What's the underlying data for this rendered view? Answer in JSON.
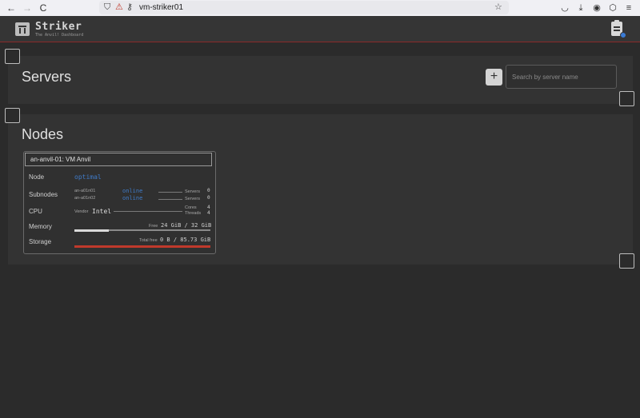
{
  "browser": {
    "url": "vm-striker01",
    "back_icon": "←",
    "forward_icon": "→",
    "reload_icon": "C"
  },
  "app": {
    "title": "Striker",
    "subtitle": "The Anvil! Dashboard"
  },
  "servers": {
    "heading": "Servers",
    "add_label": "+",
    "search_placeholder": "Search by server name"
  },
  "nodes": {
    "heading": "Nodes",
    "card": {
      "title": "an-anvil-01: VM Anvil",
      "node": {
        "label": "Node",
        "status": "optimal"
      },
      "subnodes": {
        "label": "Subnodes",
        "items": [
          {
            "name": "an-a01n01",
            "status": "online",
            "servers_label": "Servers",
            "servers": "0"
          },
          {
            "name": "an-a01n02",
            "status": "online",
            "servers_label": "Servers",
            "servers": "0"
          }
        ]
      },
      "cpu": {
        "label": "CPU",
        "vendor_label": "Vendor",
        "vendor": "Intel",
        "cores_label": "Cores",
        "cores": "4",
        "threads_label": "Threads",
        "threads": "4"
      },
      "memory": {
        "label": "Memory",
        "free_label": "Free",
        "value": "24 GiB / 32 GiB",
        "used_fraction": 0.25
      },
      "storage": {
        "label": "Storage",
        "free_label": "Total free",
        "value": "0 B / 85.73 GiB",
        "used_fraction": 1.0
      }
    }
  },
  "colors": {
    "accent_blue": "#3f7bc9",
    "storage_bar": "#c0392b",
    "memory_bar": "#d9d9d9",
    "header_border": "#8a2a2a"
  }
}
